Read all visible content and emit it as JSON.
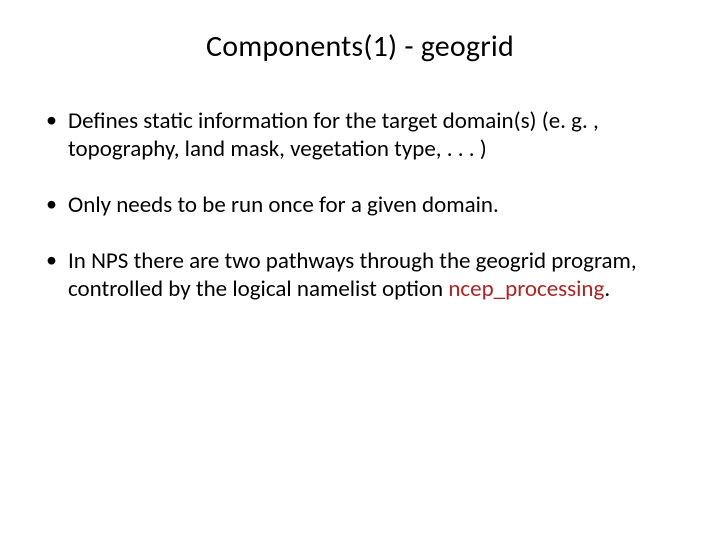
{
  "title": "Components(1) - geogrid",
  "bullets": [
    {
      "text": "Defines static information for the target domain(s) (e. g. , topography, land mask, vegetation type, . . . )"
    },
    {
      "text": "Only needs to be run once for a given domain."
    },
    {
      "prefix": "In NPS there are two pathways through the geogrid program, controlled by the logical namelist option ",
      "keyword": "ncep_processing",
      "suffix": "."
    }
  ]
}
